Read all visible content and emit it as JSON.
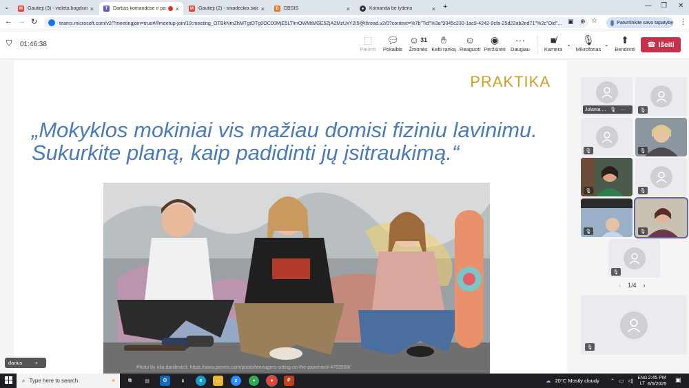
{
  "browser": {
    "tabs": [
      {
        "label": "Gautieji (3) - violeta.bogdiun@",
        "icon": "gmail-icon",
        "active": false
      },
      {
        "label": "Darbas komandose ir pasid",
        "icon": "teams-icon",
        "active": true
      },
      {
        "label": "Gautieji (2) - sniadeckio.salcinin",
        "icon": "gmail-icon",
        "active": false
      },
      {
        "label": "DBSIS",
        "icon": "dbsis-icon",
        "active": false
      },
      {
        "label": "Komanda be lyderio",
        "icon": "page-icon",
        "active": false
      }
    ],
    "url": "teams.microsoft.com/v2/?meetingjoin=true#/l/meetup-join/19:meeting_OTBkNmZhMTgtOTg0OC00MjE5LTlmOWMtMGE5ZjA2MzUxY2I5@thread.v2/0?context=%7b\"Tid\"%3a\"9345c230-1ac9-4242-9cfa-25d22ab2ed71\"%2c\"Oid\"...",
    "verify_label": "Patvirtinkite savo tapatybę"
  },
  "meeting": {
    "timer": "01:46:38",
    "toolbar": {
      "take_control": "Perimti",
      "chat": "Pokalbis",
      "people": "Žmonės",
      "people_count": "31",
      "raise": "Kelti ranką",
      "react": "Reaguoti",
      "view": "Peržiūrėti",
      "more": "Daugiau",
      "camera": "Kamera",
      "mic": "Mikrofonas",
      "share": "Bendrinti",
      "leave": "Išeiti"
    },
    "presenter_name": "darius"
  },
  "slide": {
    "heading": "PRAKTIKA",
    "quote": "„Mokyklos mokiniai vis mažiau domisi fiziniu lavinimu. Sukurkite planą, kaip padidinti jų įsitraukimą.“",
    "photo_credit": "Photo by olia danilevich: https://www.pexels.com/photo/teenagers-sitting-on-the-pavement-4753998/"
  },
  "participants": {
    "first_name": "Jolanta ...",
    "page_label": "1/4"
  },
  "taskbar": {
    "search_placeholder": "Type here to search",
    "weather": "20°C  Mostly cloudy",
    "lang": "ENG",
    "lang2": "LT",
    "time": "2:45 PM",
    "date": "6/5/2025"
  },
  "colors": {
    "accent": "#6264a7",
    "leave": "#c4314b",
    "quote": "#4a7ab8",
    "heading": "#c9a227"
  }
}
